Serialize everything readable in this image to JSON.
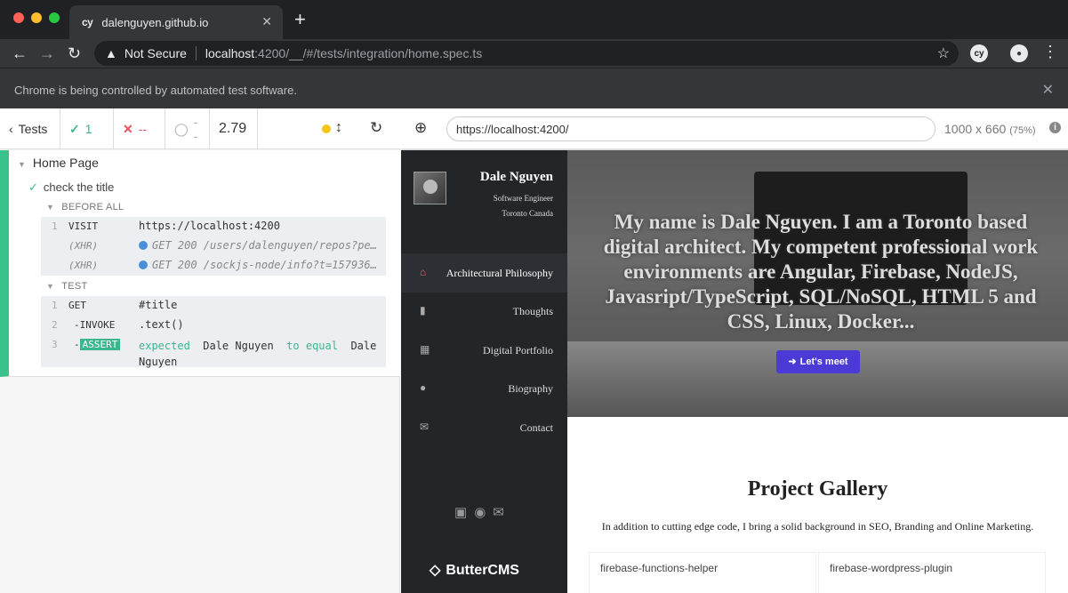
{
  "browser": {
    "tab_title": "dalenguyen.github.io",
    "tab_icon": "cy",
    "security": "Not Secure",
    "url_host": "localhost",
    "url_path": ":4200/__/#/tests/integration/home.spec.ts",
    "ext_icon": "cy",
    "infobar": "Chrome is being controlled by automated test software."
  },
  "reporter": {
    "tests_label": "Tests",
    "passed": "1",
    "failed": "--",
    "pending": "--",
    "duration": "2.79",
    "suite": "Home Page",
    "test": "check the title",
    "hooks": {
      "before": "BEFORE ALL",
      "test": "TEST"
    },
    "before_cmds": [
      {
        "num": "1",
        "name": "VISIT",
        "msg": "https://localhost:4200"
      },
      {
        "num": "",
        "name": "(XHR)",
        "msg": "GET 200 /users/dalenguyen/repos?pe…"
      },
      {
        "num": "",
        "name": "(XHR)",
        "msg": "GET 200 /sockjs-node/info?t=157936…"
      }
    ],
    "test_cmds": [
      {
        "num": "1",
        "name": "GET",
        "msg": "#title"
      },
      {
        "num": "2",
        "name": "-INVOKE",
        "msg": ".text()"
      },
      {
        "num": "3",
        "name": "ASSERT",
        "msg_a": "expected",
        "msg_b": "Dale Nguyen",
        "msg_c": "to equal",
        "msg_d": "Dale",
        "msg_e": "Nguyen"
      }
    ]
  },
  "aut": {
    "url": "https://localhost:4200/",
    "viewport": "1000 x 660",
    "scale": "(75%)"
  },
  "site": {
    "name": "Dale Nguyen",
    "title": "Software Engineer",
    "location": "Toronto Canada",
    "nav": [
      {
        "label": "Architectural Philosophy",
        "icon": "home-icon"
      },
      {
        "label": "Thoughts",
        "icon": "book-icon"
      },
      {
        "label": "Digital Portfolio",
        "icon": "grid-icon"
      },
      {
        "label": "Biography",
        "icon": "user-icon"
      },
      {
        "label": "Contact",
        "icon": "envelope-icon"
      }
    ],
    "hero_text": "My name is Dale Nguyen. I am a Toronto based digital architect. My competent professional work environments are Angular, Firebase, NodeJS, Javasript/TypeScript, SQL/NoSQL, HTML 5 and CSS, Linux, Docker...",
    "cta": "Let's meet",
    "gallery_title": "Project Gallery",
    "gallery_sub": "In addition to cutting edge code, I bring a solid background in SEO, Branding and Online Marketing.",
    "cards": [
      "firebase-functions-helper",
      "firebase-wordpress-plugin"
    ],
    "sponsor": "ButterCMS"
  }
}
